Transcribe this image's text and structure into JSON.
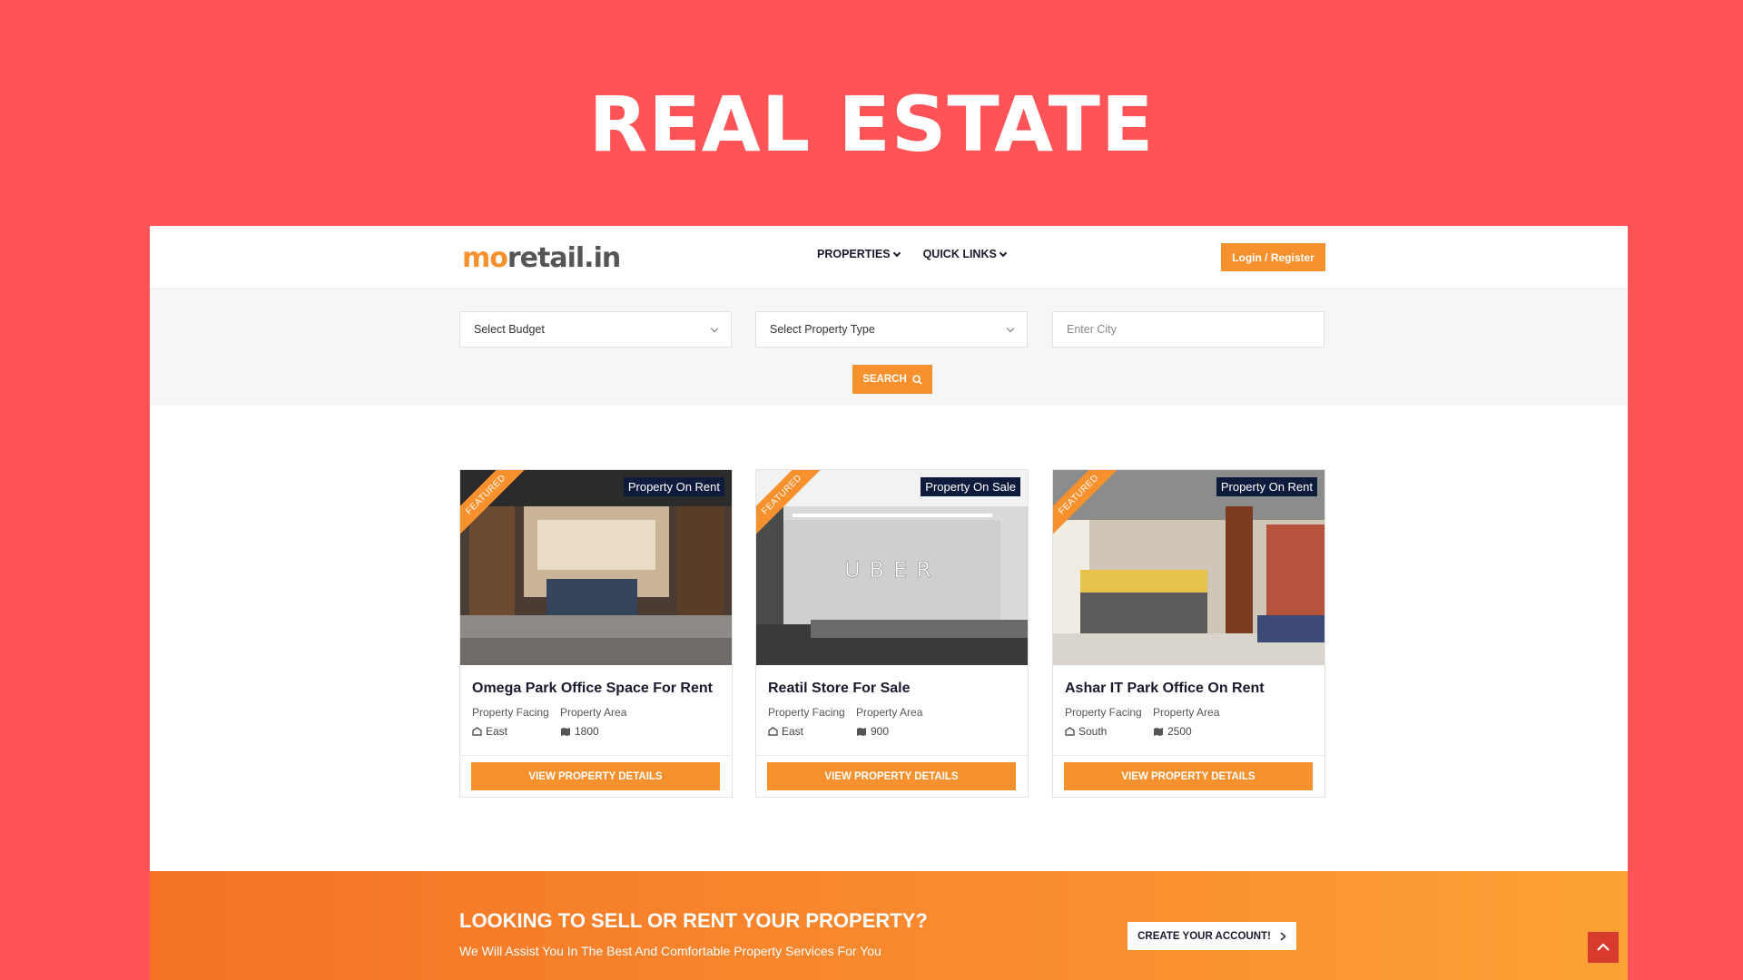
{
  "hero": {
    "title": "REAL ESTATE"
  },
  "header": {
    "logo_mo": "mo",
    "logo_rest": "retail.in",
    "nav": [
      {
        "label": "PROPERTIES"
      },
      {
        "label": "QUICK LINKS"
      }
    ],
    "login_label": "Login / Register"
  },
  "search": {
    "budget_placeholder": "Select Budget",
    "type_placeholder": "Select Property Type",
    "city_placeholder": "Enter City",
    "button_label": "SEARCH"
  },
  "cards": [
    {
      "ribbon": "FEATURED",
      "badge": "Property On Rent",
      "title": "Omega Park Office Space For Rent",
      "facing_label": "Property Facing",
      "area_label": "Property Area",
      "facing": "East",
      "area": "1800",
      "button": "VIEW PROPERTY DETAILS"
    },
    {
      "ribbon": "FEATURED",
      "badge": "Property On Sale",
      "title": "Reatil Store For Sale",
      "facing_label": "Property Facing",
      "area_label": "Property Area",
      "facing": "East",
      "area": "900",
      "button": "VIEW PROPERTY DETAILS",
      "sign_text": "UBER"
    },
    {
      "ribbon": "FEATURED",
      "badge": "Property On Rent",
      "title": "Ashar IT Park Office On Rent",
      "facing_label": "Property Facing",
      "area_label": "Property Area",
      "facing": "South",
      "area": "2500",
      "button": "VIEW PROPERTY DETAILS"
    }
  ],
  "cta": {
    "title": "LOOKING TO SELL OR RENT YOUR PROPERTY?",
    "subtitle": "We Will Assist You In The Best And Comfortable Property Services For You",
    "button": "CREATE YOUR ACCOUNT!"
  },
  "colors": {
    "background": "#fe5457",
    "accent": "#f7912e",
    "badge": "#0f1b3d"
  },
  "icons": {
    "search": "search-icon",
    "facing": "compass-icon",
    "area": "map-icon",
    "back_to_top": "chevron-up-icon"
  }
}
